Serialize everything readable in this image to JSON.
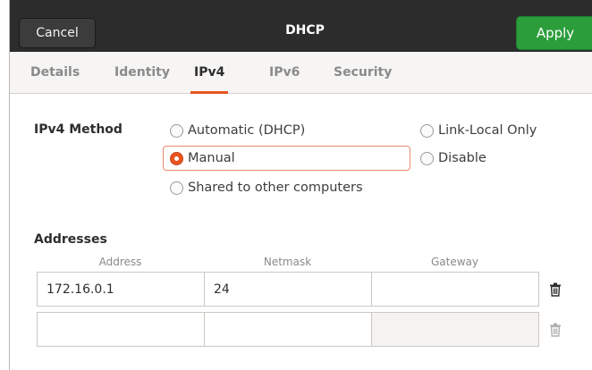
{
  "header": {
    "cancel_label": "Cancel",
    "title": "DHCP",
    "apply_label": "Apply"
  },
  "tabs": [
    {
      "label": "Details",
      "active": false
    },
    {
      "label": "Identity",
      "active": false
    },
    {
      "label": "IPv4",
      "active": true
    },
    {
      "label": "IPv6",
      "active": false
    },
    {
      "label": "Security",
      "active": false
    }
  ],
  "method": {
    "label": "IPv4 Method",
    "options": {
      "automatic": {
        "label": "Automatic (DHCP)",
        "checked": false
      },
      "link_local": {
        "label": "Link-Local Only",
        "checked": false
      },
      "manual": {
        "label": "Manual",
        "checked": true
      },
      "disable": {
        "label": "Disable",
        "checked": false
      },
      "shared": {
        "label": "Shared to other computers",
        "checked": false
      }
    }
  },
  "addresses": {
    "label": "Addresses",
    "columns": {
      "address": "Address",
      "netmask": "Netmask",
      "gateway": "Gateway"
    },
    "rows": [
      {
        "address": "172.16.0.1",
        "netmask": "24",
        "gateway": ""
      },
      {
        "address": "",
        "netmask": "",
        "gateway": ""
      }
    ]
  },
  "icons": {
    "delete": "trash-icon"
  },
  "colors": {
    "accent": "#e95420",
    "apply": "#2b9d3b",
    "headerbar": "#2c2c2c"
  }
}
